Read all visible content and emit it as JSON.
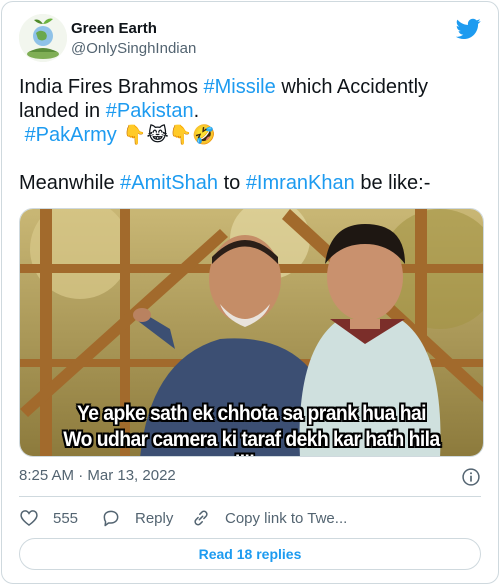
{
  "user": {
    "display_name": "Green Earth",
    "handle": "@OnlySinghIndian",
    "avatar_icon": "globe-plant-avatar"
  },
  "tweet": {
    "lines": [
      [
        {
          "t": "India Fires Brahmos "
        },
        {
          "t": "#Missile",
          "tag": true
        },
        {
          "t": " which Accidently"
        }
      ],
      [
        {
          "t": "landed in "
        },
        {
          "t": "#Pakistan",
          "tag": true
        },
        {
          "t": "."
        }
      ],
      [
        {
          "t": " "
        },
        {
          "t": "#PakArmy",
          "tag": true
        },
        {
          "t": " 👇😹👇🤣",
          "emoji": true
        }
      ],
      [
        {
          "t": " "
        }
      ],
      [
        {
          "t": "Meanwhile "
        },
        {
          "t": "#AmitShah",
          "tag": true
        },
        {
          "t": " to "
        },
        {
          "t": "#ImranKhan",
          "tag": true
        },
        {
          "t": " be like:-"
        }
      ]
    ],
    "timestamp": "8:25 AM · Mar 13, 2022"
  },
  "media": {
    "caption_line1": "Ye apke sath ek chhota sa prank hua hai",
    "caption_line2": "Wo udhar camera ki taraf dekh kar hath hila dijiye"
  },
  "actions": {
    "like_count": "555",
    "reply_label": "Reply",
    "copy_label": "Copy link to Twe..."
  },
  "read_replies_label": "Read 18 replies",
  "colors": {
    "link": "#1d9bf0",
    "muted": "#536471",
    "border": "#cfd9de"
  }
}
